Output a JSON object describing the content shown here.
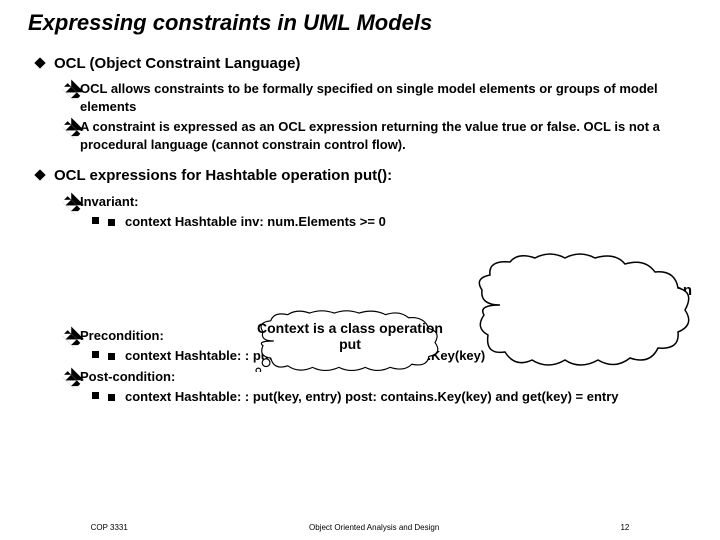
{
  "title": "Expressing constraints in UML Models",
  "s1": {
    "heading": "OCL (Object Constraint Language)",
    "p1": "OCL allows constraints to be formally specified on single model elements or groups of model elements",
    "p2": "A constraint is expressed as an OCL expression returning the value true or false.  OCL is not a procedural language (cannot constrain control flow)."
  },
  "s2": {
    "heading": "OCL expressions for Hashtable operation put():",
    "inv_label": "Invariant:",
    "inv_text": "context Hashtable inv: num.Elements >= 0",
    "pre_label": "Precondition:",
    "pre_text": "context Hashtable: : put(key, entry) pre:!contains.Key(key)",
    "post_label": "Post-condition:",
    "post_text": "context Hashtable: : put(key, entry) post: contains.Key(key) and get(key) = entry"
  },
  "callout": {
    "label": "OCL expression",
    "bubble": "Context is a class operation put"
  },
  "footer": {
    "left": "COP 3331",
    "center": "Object Oriented Analysis and Design",
    "right": "12"
  }
}
